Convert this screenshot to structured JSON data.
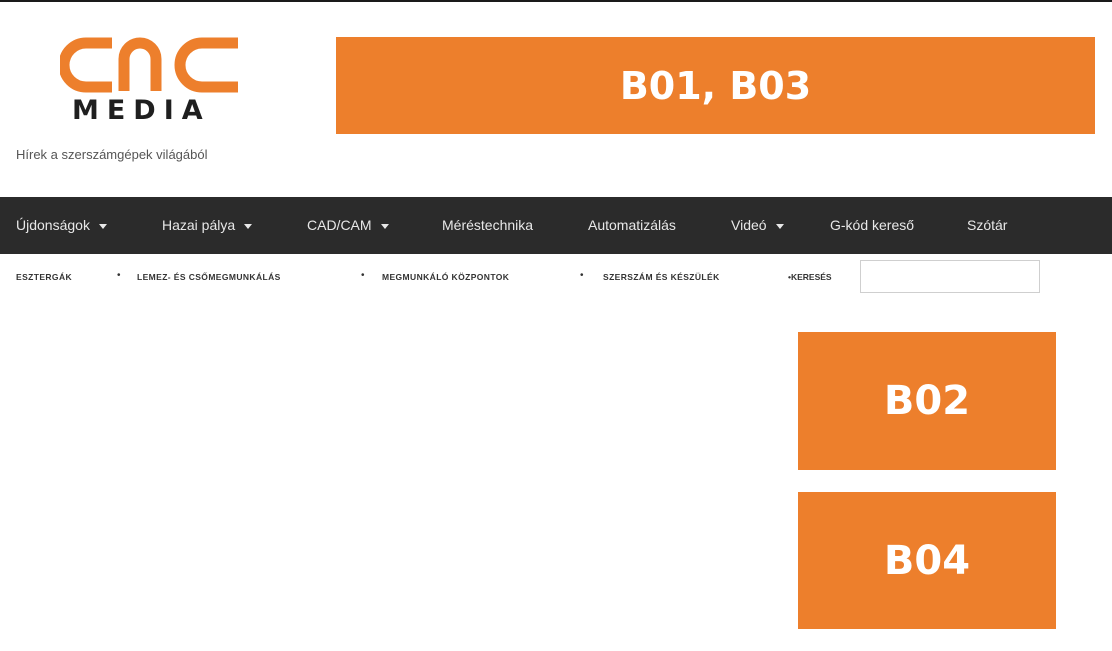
{
  "logo": {
    "top_text": "cnc",
    "bottom_text": "MEDIA",
    "brand_color": "#ed7f2c"
  },
  "tagline": "Hírek a szerszámgépek világából",
  "banners": {
    "top": "B01, B03",
    "side_1": "B02",
    "side_2": "B04",
    "color": "#ed7f2c"
  },
  "nav": {
    "items": [
      {
        "label": "Újdonságok",
        "dropdown": true
      },
      {
        "label": "Hazai pálya",
        "dropdown": true
      },
      {
        "label": "CAD/CAM",
        "dropdown": true
      },
      {
        "label": "Méréstechnika",
        "dropdown": false
      },
      {
        "label": "Automatizálás",
        "dropdown": false
      },
      {
        "label": "Videó",
        "dropdown": true
      },
      {
        "label": "G-kód kereső",
        "dropdown": false
      },
      {
        "label": "Szótár",
        "dropdown": false
      }
    ],
    "background": "#2b2b2b"
  },
  "subnav": {
    "items": [
      "ESZTERGÁK",
      "LEMEZ- ÉS CSŐMEGMUNKÁLÁS",
      "MEGMUNKÁLÓ KÖZPONTOK",
      "SZERSZÁM ÉS KÉSZÜLÉK"
    ],
    "search_label": "•KERESÉS",
    "search_value": ""
  }
}
